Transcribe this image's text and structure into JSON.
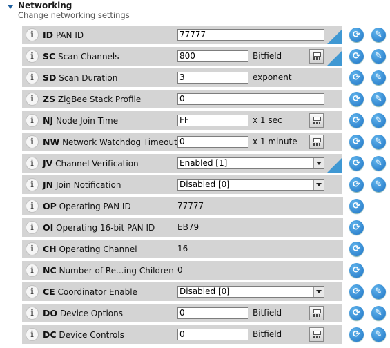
{
  "section": {
    "title": "Networking",
    "subtitle": "Change networking settings"
  },
  "icons": {
    "info": "i",
    "refresh_glyph": "⟳",
    "write_glyph": "✎"
  },
  "rows": [
    {
      "code": "ID",
      "name": "PAN ID",
      "value": "77777"
    },
    {
      "code": "SC",
      "name": "Scan Channels",
      "value": "800",
      "unit": "Bitfield"
    },
    {
      "code": "SD",
      "name": "Scan Duration",
      "value": "3",
      "unit": "exponent"
    },
    {
      "code": "ZS",
      "name": "ZigBee Stack Profile",
      "value": "0"
    },
    {
      "code": "NJ",
      "name": "Node Join Time",
      "value": "FF",
      "unit": "x 1 sec"
    },
    {
      "code": "NW",
      "name": "Network Watchdog Timeout",
      "value": "0",
      "unit": "x 1 minute"
    },
    {
      "code": "JV",
      "name": "Channel Verification",
      "value": "Enabled [1]"
    },
    {
      "code": "JN",
      "name": "Join Notification",
      "value": "Disabled [0]"
    },
    {
      "code": "OP",
      "name": "Operating PAN ID",
      "value": "77777"
    },
    {
      "code": "OI",
      "name": "Operating 16-bit PAN ID",
      "value": "EB79"
    },
    {
      "code": "CH",
      "name": "Operating Channel",
      "value": "16"
    },
    {
      "code": "NC",
      "name": "Number of Re...ing Children",
      "value": "0"
    },
    {
      "code": "CE",
      "name": "Coordinator Enable",
      "value": "Disabled [0]"
    },
    {
      "code": "DO",
      "name": "Device Options",
      "value": "0",
      "unit": "Bitfield"
    },
    {
      "code": "DC",
      "name": "Device Controls",
      "value": "0",
      "unit": "Bitfield"
    }
  ]
}
